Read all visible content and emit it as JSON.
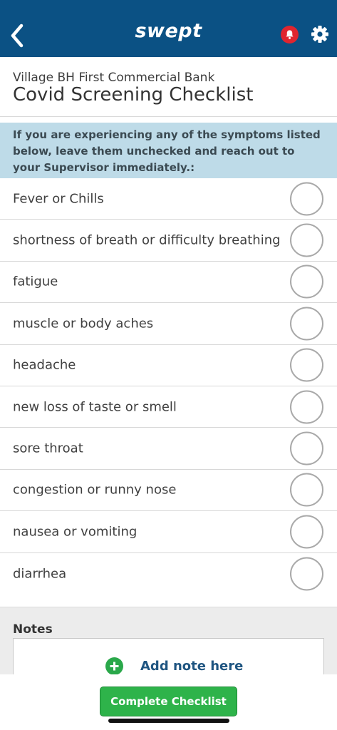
{
  "app": {
    "brand": "swept"
  },
  "colors": {
    "header_bg": "#0b5184",
    "notice_bg": "#bedbe8",
    "accent_green": "#2eb34a",
    "alert_red": "#e0252f"
  },
  "icons": {
    "back": "chevron-left-icon",
    "notifications": "bell-icon",
    "settings": "gear-icon",
    "add": "plus-circle-icon"
  },
  "checklist": {
    "location": "Village BH First Commercial Bank",
    "title": "Covid Screening Checklist",
    "notice": "If you are experiencing any of the symptoms listed below, leave them unchecked and reach out to your Supervisor immediately.:",
    "items": [
      {
        "label": "Fever or Chills",
        "checked": false
      },
      {
        "label": "shortness of breath or difficulty breathing",
        "checked": false
      },
      {
        "label": "fatigue",
        "checked": false
      },
      {
        "label": "muscle or body aches",
        "checked": false
      },
      {
        "label": "headache",
        "checked": false
      },
      {
        "label": "new loss of taste or smell",
        "checked": false
      },
      {
        "label": "sore throat",
        "checked": false
      },
      {
        "label": "congestion or runny nose",
        "checked": false
      },
      {
        "label": "nausea or vomiting",
        "checked": false
      },
      {
        "label": "diarrhea",
        "checked": false
      }
    ]
  },
  "notes": {
    "title": "Notes",
    "add_label": "Add note here"
  },
  "footer": {
    "complete_label": "Complete Checklist"
  }
}
